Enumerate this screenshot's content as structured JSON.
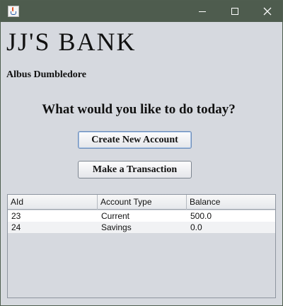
{
  "window": {
    "icon": "java-cup-icon",
    "controls": {
      "minimize": "minimize-icon",
      "maximize": "maximize-icon",
      "close": "close-icon"
    }
  },
  "header": {
    "bank_name": "JJ'S BANK",
    "user_name": "Albus Dumbledore",
    "prompt": "What would you like to do today?"
  },
  "actions": {
    "create_account_label": "Create New Account",
    "transaction_label": "Make a Transaction"
  },
  "accounts_table": {
    "columns": [
      "AId",
      "Account Type",
      "Balance"
    ],
    "rows": [
      [
        "23",
        "Current",
        "500.0"
      ],
      [
        "24",
        "Savings",
        "0.0"
      ]
    ]
  },
  "colors": {
    "titlebar": "#4e5c4e",
    "window_bg": "#d6d9df",
    "focus_border": "#6f8fbb"
  }
}
